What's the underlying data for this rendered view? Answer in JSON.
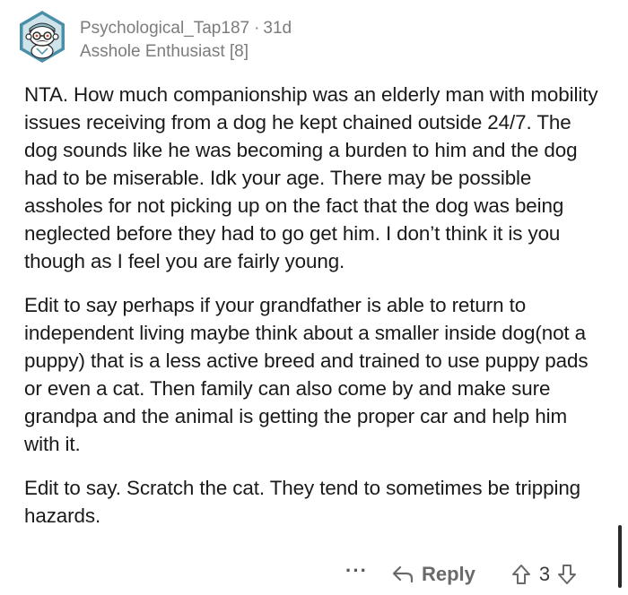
{
  "comment": {
    "author": "Psychological_Tap187",
    "separator": "·",
    "age": "31d",
    "flair": "Asshole Enthusiast [8]",
    "paragraphs": [
      "NTA.  How much companionship  was an elderly man with mobility issues receiving from a dog he kept chained outside 24/7.  The dog sounds like he was becoming a burden to him and the dog had to be miserable.   Idk your age.  There may be possible assholes for not picking up on the fact that the dog was being neglected before they had to go get him.  I don’t think it is you though as I feel you are fairly young.",
      "Edit to say perhaps if your grandfather is able to return to independent living maybe think about a smaller inside dog(not a puppy) that is a less active breed and trained to use puppy pads or even a cat. Then family can also come by and make sure grandpa and the animal is getting the proper car and help him with it.",
      "Edit to say. Scratch the cat.  They tend to sometimes be tripping hazards."
    ],
    "actions": {
      "more": "···",
      "reply": "Reply",
      "score": "3"
    }
  },
  "icons": {
    "avatar": "avatar-icon",
    "reply": "reply-arrow-icon",
    "upvote": "upvote-arrow-icon",
    "downvote": "downvote-arrow-icon"
  },
  "colors": {
    "meta_text": "#7c7c7c",
    "body_text": "#1a1a1a",
    "avatar_hex": "#4a8fa8",
    "avatar_bg": "#cfe3ea"
  }
}
